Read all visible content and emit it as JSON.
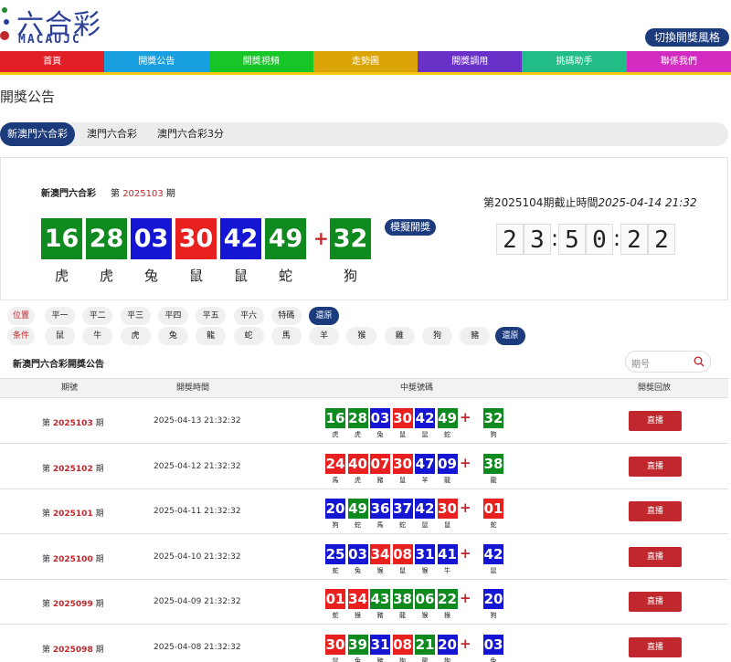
{
  "header": {
    "logo_title": "六合彩",
    "logo_sub": "MACAUJC",
    "style_switch": "切換開獎風格"
  },
  "nav": [
    {
      "label": "首頁",
      "color": "#e11f26"
    },
    {
      "label": "開獎公告",
      "color": "#189fe0"
    },
    {
      "label": "開獎視頻",
      "color": "#15c626"
    },
    {
      "label": "走勢圖",
      "color": "#dba408"
    },
    {
      "label": "開獎調用",
      "color": "#6a31c9"
    },
    {
      "label": "挑碼助手",
      "color": "#22bd87"
    },
    {
      "label": "聯係我們",
      "color": "#d12bc0"
    }
  ],
  "page_title": "開獎公告",
  "tabs": [
    "新澳門六合彩",
    "澳門六合彩",
    "澳門六合彩3分"
  ],
  "current": {
    "name": "新澳門六合彩",
    "issue_prefix": "第",
    "issue": "2025103",
    "issue_suffix": "期",
    "balls": [
      {
        "num": "16",
        "zodiac": "虎",
        "color": "green"
      },
      {
        "num": "28",
        "zodiac": "虎",
        "color": "green"
      },
      {
        "num": "03",
        "zodiac": "兔",
        "color": "blue"
      },
      {
        "num": "30",
        "zodiac": "鼠",
        "color": "red"
      },
      {
        "num": "42",
        "zodiac": "鼠",
        "color": "blue"
      },
      {
        "num": "49",
        "zodiac": "蛇",
        "color": "green"
      }
    ],
    "special": {
      "num": "32",
      "zodiac": "狗",
      "color": "green"
    },
    "simulate": "模擬開獎",
    "deadline_label": "第2025104期截止時間",
    "deadline_time": "2025-04-14 21:32",
    "countdown": [
      "2",
      "3",
      ":",
      "5",
      "0",
      ":",
      "2",
      "2"
    ]
  },
  "filters": {
    "position_label": "位置",
    "positions": [
      "平一",
      "平二",
      "平三",
      "平四",
      "平五",
      "平六",
      "特碼"
    ],
    "position_reset": "還原",
    "condition_label": "条件",
    "conditions": [
      "鼠",
      "牛",
      "虎",
      "兔",
      "龍",
      "蛇",
      "馬",
      "羊",
      "猴",
      "雞",
      "狗",
      "豬"
    ],
    "condition_reset": "還原"
  },
  "list": {
    "title": "新澳門六合彩開獎公告",
    "search_placeholder": "期号",
    "headers": [
      "期號",
      "開獎時間",
      "中獎號碼",
      "開獎回放"
    ],
    "play_label": "直播",
    "rows": [
      {
        "issue": "2025103",
        "date": "2025-04-13 21:32:32",
        "balls": [
          [
            "16",
            "虎",
            "green"
          ],
          [
            "28",
            "虎",
            "green"
          ],
          [
            "03",
            "兔",
            "blue"
          ],
          [
            "30",
            "鼠",
            "red"
          ],
          [
            "42",
            "鼠",
            "blue"
          ],
          [
            "49",
            "蛇",
            "green"
          ]
        ],
        "special": [
          "32",
          "狗",
          "green"
        ]
      },
      {
        "issue": "2025102",
        "date": "2025-04-12 21:32:32",
        "balls": [
          [
            "24",
            "馬",
            "red"
          ],
          [
            "40",
            "虎",
            "red"
          ],
          [
            "07",
            "豬",
            "red"
          ],
          [
            "30",
            "鼠",
            "red"
          ],
          [
            "47",
            "羊",
            "blue"
          ],
          [
            "09",
            "龍",
            "blue"
          ]
        ],
        "special": [
          "38",
          "龍",
          "green"
        ]
      },
      {
        "issue": "2025101",
        "date": "2025-04-11 21:32:32",
        "balls": [
          [
            "20",
            "狗",
            "blue"
          ],
          [
            "49",
            "蛇",
            "green"
          ],
          [
            "36",
            "馬",
            "blue"
          ],
          [
            "37",
            "蛇",
            "blue"
          ],
          [
            "42",
            "鼠",
            "blue"
          ],
          [
            "30",
            "鼠",
            "red"
          ]
        ],
        "special": [
          "01",
          "蛇",
          "red"
        ]
      },
      {
        "issue": "2025100",
        "date": "2025-04-10 21:32:32",
        "balls": [
          [
            "25",
            "蛇",
            "blue"
          ],
          [
            "03",
            "兔",
            "blue"
          ],
          [
            "34",
            "猴",
            "red"
          ],
          [
            "08",
            "鼠",
            "red"
          ],
          [
            "31",
            "猴",
            "blue"
          ],
          [
            "41",
            "牛",
            "blue"
          ]
        ],
        "special": [
          "42",
          "鼠",
          "blue"
        ]
      },
      {
        "issue": "2025099",
        "date": "2025-04-09 21:32:32",
        "balls": [
          [
            "01",
            "蛇",
            "red"
          ],
          [
            "34",
            "猴",
            "red"
          ],
          [
            "43",
            "豬",
            "green"
          ],
          [
            "38",
            "龍",
            "green"
          ],
          [
            "06",
            "猴",
            "green"
          ],
          [
            "22",
            "猴",
            "green"
          ]
        ],
        "special": [
          "20",
          "狗",
          "blue"
        ]
      },
      {
        "issue": "2025098",
        "date": "2025-04-08 21:32:32",
        "balls": [
          [
            "30",
            "鼠",
            "red"
          ],
          [
            "39",
            "兔",
            "green"
          ],
          [
            "31",
            "豬",
            "blue"
          ],
          [
            "08",
            "狗",
            "red"
          ],
          [
            "21",
            "龍",
            "green"
          ],
          [
            "20",
            "狗",
            "blue"
          ]
        ],
        "special": [
          "03",
          "兔",
          "blue"
        ]
      }
    ]
  },
  "colors": {
    "green": "#0e8a1e",
    "red": "#e82020",
    "blue": "#1515d4",
    "navy": "#1c3b7c",
    "accent_red": "#c0282d"
  }
}
